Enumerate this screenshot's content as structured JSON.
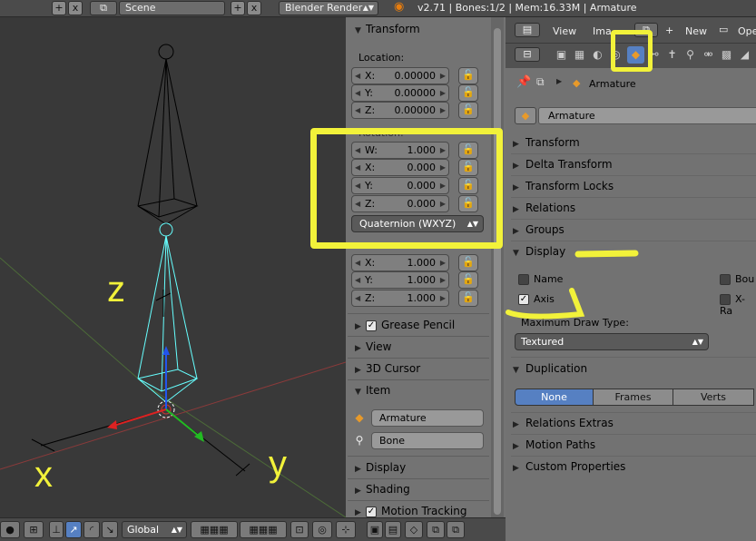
{
  "topbar": {
    "scene": "Scene",
    "engine": "Blender Render",
    "info": "v2.71 | Bones:1/2 | Mem:16.33M | Armature",
    "plus": "+",
    "close": "x"
  },
  "npanel": {
    "transform_header": "Transform",
    "location_label": "Location:",
    "location": [
      {
        "axis": "X:",
        "value": "0.00000"
      },
      {
        "axis": "Y:",
        "value": "0.00000"
      },
      {
        "axis": "Z:",
        "value": "0.00000"
      }
    ],
    "rotation_label": "Rotation:",
    "rotation": [
      {
        "axis": "W:",
        "value": "1.000"
      },
      {
        "axis": "X:",
        "value": "0.000"
      },
      {
        "axis": "Y:",
        "value": "0.000"
      },
      {
        "axis": "Z:",
        "value": "0.000"
      }
    ],
    "rotation_mode": "Quaternion (WXYZ)",
    "scale": [
      {
        "axis": "X:",
        "value": "1.000"
      },
      {
        "axis": "Y:",
        "value": "1.000"
      },
      {
        "axis": "Z:",
        "value": "1.000"
      }
    ],
    "panels": [
      "Grease Pencil",
      "View",
      "3D Cursor",
      "Item"
    ],
    "item": {
      "object": "Armature",
      "bone": "Bone"
    },
    "lower_panels": [
      "Display",
      "Shading",
      "Motion Tracking"
    ]
  },
  "props": {
    "header": {
      "view": "View",
      "image": "Ima",
      "new": "New",
      "open": "Ope"
    },
    "context": "Armature",
    "object_name": "Armature",
    "sections": [
      "Transform",
      "Delta Transform",
      "Transform Locks",
      "Relations",
      "Groups"
    ],
    "display": {
      "header": "Display",
      "name": "Name",
      "axis": "Axis",
      "bounds": "Bou",
      "xray": "X-Ra",
      "max_draw_label": "Maximum Draw Type:",
      "max_draw_value": "Textured"
    },
    "duplication": {
      "header": "Duplication",
      "options": [
        "None",
        "Frames",
        "Verts"
      ]
    },
    "more_sections": [
      "Relations Extras",
      "Motion Paths",
      "Custom Properties"
    ]
  },
  "bottombar": {
    "orientation": "Global"
  },
  "annotations": {
    "z": "z",
    "x": "x",
    "y": "y"
  },
  "colors": {
    "highlight": "#f2f23a",
    "active_tab": "#5680c2"
  }
}
